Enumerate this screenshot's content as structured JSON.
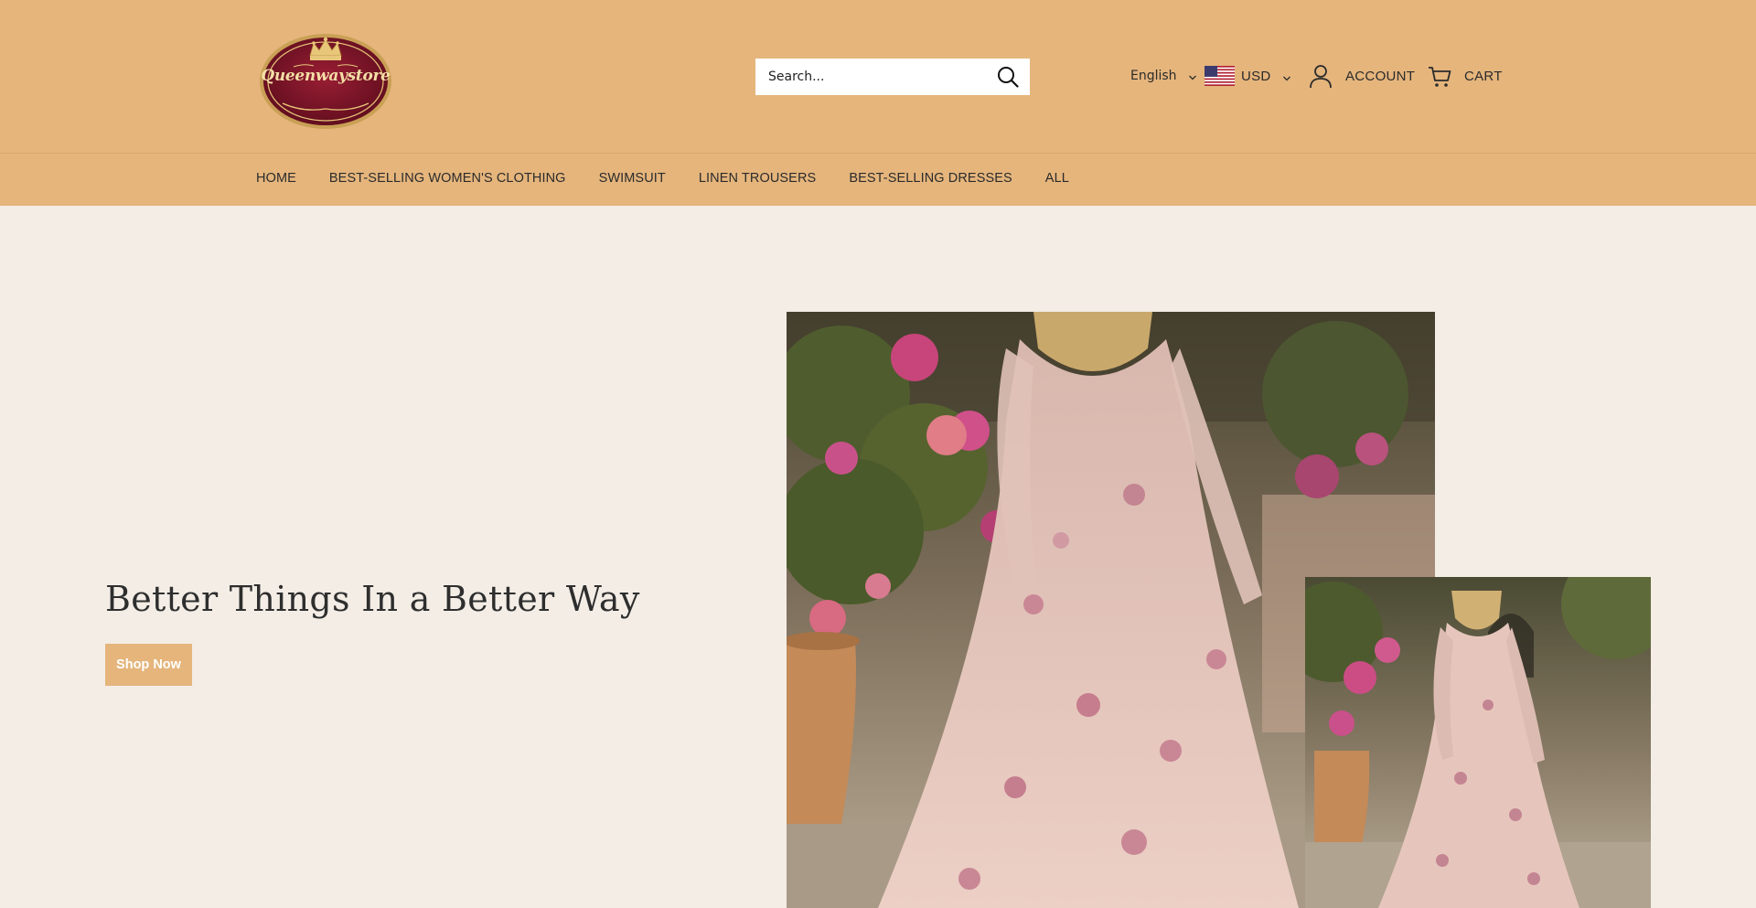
{
  "brand": {
    "logo_text": "Queenwaystore"
  },
  "search": {
    "placeholder": "Search..."
  },
  "utilities": {
    "language": "English",
    "currency": "USD",
    "account_label": "ACCOUNT",
    "cart_label": "CART"
  },
  "nav": {
    "items": [
      {
        "label": "HOME"
      },
      {
        "label": "BEST-SELLING WOMEN'S CLOTHING"
      },
      {
        "label": "SWIMSUIT"
      },
      {
        "label": "LINEN TROUSERS"
      },
      {
        "label": "BEST-SELLING DRESSES"
      },
      {
        "label": "ALL"
      }
    ]
  },
  "hero": {
    "title": "Better Things In a Better Way",
    "button_label": "Shop Now"
  },
  "colors": {
    "header_bg": "#e5b57c",
    "page_bg": "#f3ede6",
    "logo_maroon": "#7a1428",
    "logo_gold": "#e8c77a"
  },
  "icons": {
    "search": "search-icon",
    "account": "user-icon",
    "cart": "cart-icon",
    "flag": "us-flag-icon",
    "chevron": "chevron-down-icon"
  }
}
